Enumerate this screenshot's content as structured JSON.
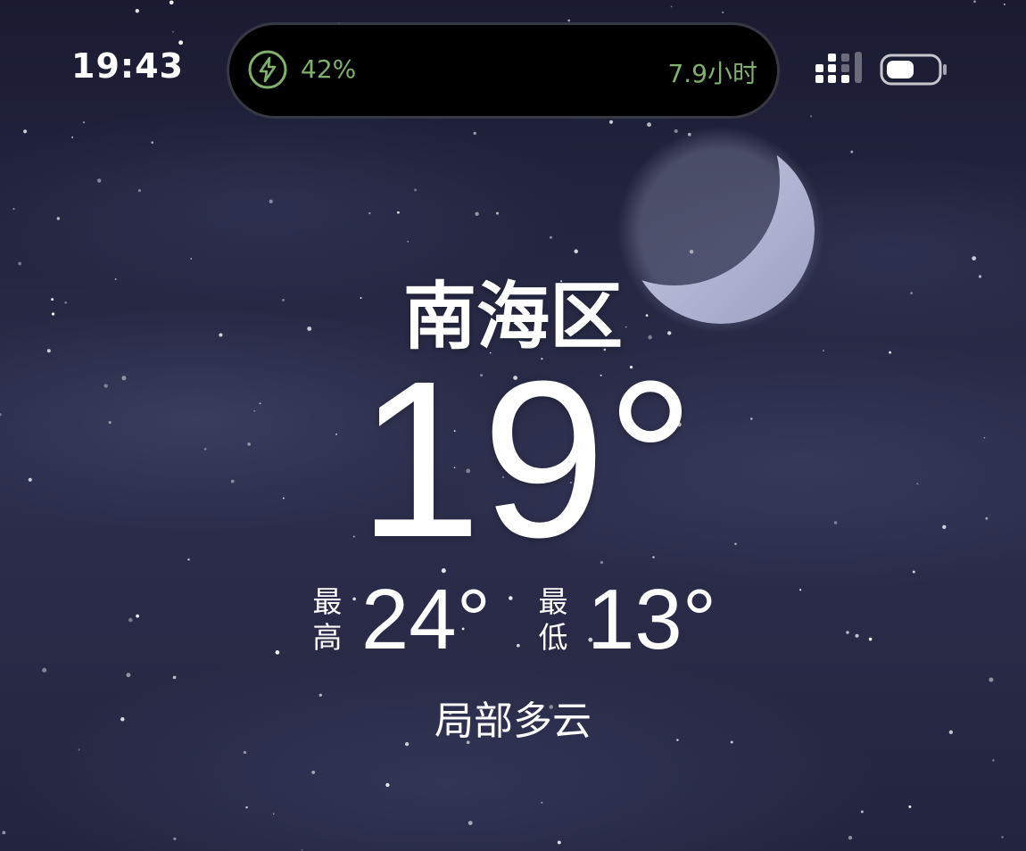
{
  "status_bar": {
    "time": "19:43",
    "icons": [
      "signal-icon",
      "battery-icon"
    ]
  },
  "dynamic_island": {
    "charging_icon": "lightning-bolt-icon",
    "battery_percent": "42%",
    "battery_level": 0.42,
    "time_remaining": "7.9小时",
    "accent_color": "#7fb16c"
  },
  "weather": {
    "location": "南海区",
    "current_temp": "19°",
    "high_label": "最高",
    "high_temp": "24°",
    "low_label": "最低",
    "low_temp": "13°",
    "condition": "局部多云",
    "background_icon": "crescent-moon-icon"
  }
}
